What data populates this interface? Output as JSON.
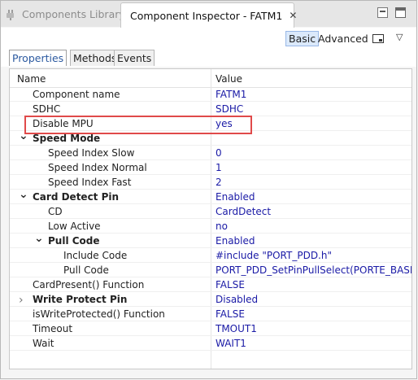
{
  "tabs": {
    "inactive_label": "Components Library",
    "active_label": "Component Inspector - FATM1",
    "close_glyph": "✕"
  },
  "toolbar": {
    "basic_label": "Basic",
    "advanced_label": "Advanced",
    "menu_glyph": "▽"
  },
  "subtabs": [
    "Properties",
    "Methods",
    "Events"
  ],
  "table": {
    "header_name": "Name",
    "header_value": "Value",
    "rows": [
      {
        "name": "Component name",
        "value": "FATM1",
        "level": 1,
        "bold": false,
        "twisty": ""
      },
      {
        "name": "SDHC",
        "value": "SDHC",
        "level": 1,
        "bold": false,
        "twisty": ""
      },
      {
        "name": "Disable MPU",
        "value": "yes",
        "level": 1,
        "bold": false,
        "twisty": ""
      },
      {
        "name": "Speed Mode",
        "value": "",
        "level": 0,
        "bold": true,
        "twisty": "expanded"
      },
      {
        "name": "Speed Index Slow",
        "value": "0",
        "level": 2,
        "bold": false,
        "twisty": ""
      },
      {
        "name": "Speed Index Normal",
        "value": "1",
        "level": 2,
        "bold": false,
        "twisty": ""
      },
      {
        "name": "Speed Index Fast",
        "value": "2",
        "level": 2,
        "bold": false,
        "twisty": ""
      },
      {
        "name": "Card Detect Pin",
        "value": "Enabled",
        "level": 0,
        "bold": true,
        "twisty": "expanded"
      },
      {
        "name": "CD",
        "value": "CardDetect",
        "level": 2,
        "bold": false,
        "twisty": ""
      },
      {
        "name": "Low Active",
        "value": "no",
        "level": 2,
        "bold": false,
        "twisty": ""
      },
      {
        "name": "Pull Code",
        "value": "Enabled",
        "level": 1,
        "bold": true,
        "twisty": "expanded"
      },
      {
        "name": "Include Code",
        "value": "#include \"PORT_PDD.h\"",
        "level": 3,
        "bold": false,
        "twisty": ""
      },
      {
        "name": "Pull Code",
        "value": "PORT_PDD_SetPinPullSelect(PORTE_BASE_PTR",
        "level": 3,
        "bold": false,
        "twisty": ""
      },
      {
        "name": "CardPresent() Function",
        "value": "FALSE",
        "level": 1,
        "bold": false,
        "twisty": ""
      },
      {
        "name": "Write Protect Pin",
        "value": "Disabled",
        "level": 0,
        "bold": true,
        "twisty": "collapsed"
      },
      {
        "name": "isWriteProtected() Function",
        "value": "FALSE",
        "level": 1,
        "bold": false,
        "twisty": ""
      },
      {
        "name": "Timeout",
        "value": "TMOUT1",
        "level": 1,
        "bold": false,
        "twisty": ""
      },
      {
        "name": "Wait",
        "value": "WAIT1",
        "level": 1,
        "bold": false,
        "twisty": ""
      }
    ]
  },
  "colors": {
    "value_text": "#1a1aa6",
    "highlight_border": "#e04a4a",
    "selected_subtab": "#2c5aa0"
  }
}
